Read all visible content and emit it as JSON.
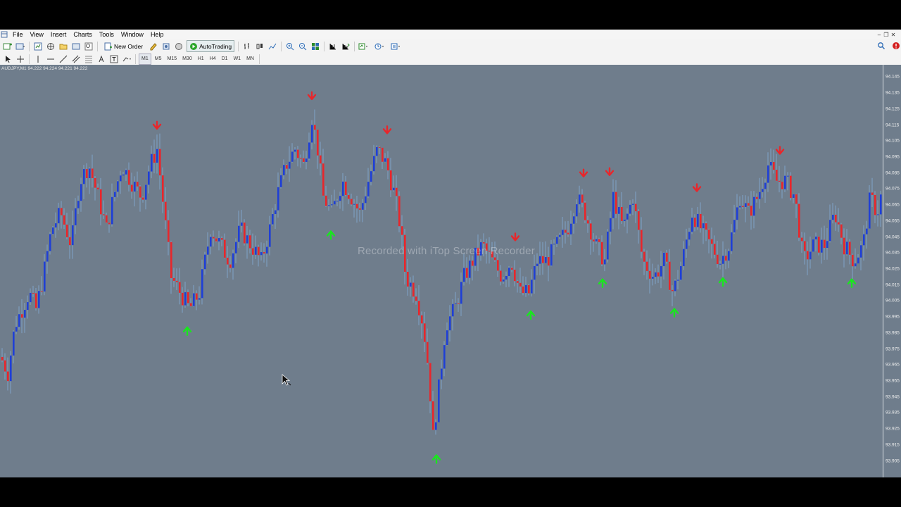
{
  "menu": [
    "File",
    "View",
    "Insert",
    "Charts",
    "Tools",
    "Window",
    "Help"
  ],
  "toolbar": {
    "new_order_label": "New Order",
    "autotrading_label": "AutoTrading"
  },
  "timeframes": [
    "M1",
    "M5",
    "M15",
    "M30",
    "H1",
    "H4",
    "D1",
    "W1",
    "MN"
  ],
  "active_timeframe": "M1",
  "chart_header": "AUDJPY,M1  94.222 94.224 94.221 94.222",
  "watermark": "Recorded with iTop Screen Recorder",
  "price_labels": [
    "94.145",
    "94.135",
    "94.125",
    "94.115",
    "94.105",
    "94.095",
    "94.085",
    "94.075",
    "94.065",
    "94.055",
    "94.045",
    "94.035",
    "94.025",
    "94.015",
    "94.005",
    "93.995",
    "93.985",
    "93.975",
    "93.965",
    "93.955",
    "93.945",
    "93.935",
    "93.925",
    "93.915",
    "93.905"
  ],
  "colors": {
    "background": "#6f7d8c",
    "bull_candle": "#1f3fd6",
    "bear_candle": "#e8262b",
    "wick": "#7fa3c8",
    "buy_arrow": "#19e61e",
    "sell_arrow": "#e8262b"
  },
  "chart_data": {
    "type": "candlestick",
    "symbol": "AUDJPY",
    "timeframe": "M1",
    "ylim": [
      93.9,
      94.15
    ],
    "close_points": [
      [
        0,
        93.97
      ],
      [
        10,
        93.96
      ],
      [
        20,
        93.99
      ],
      [
        30,
        94.0
      ],
      [
        40,
        94.01
      ],
      [
        50,
        94.0
      ],
      [
        60,
        94.02
      ],
      [
        72,
        94.05
      ],
      [
        85,
        94.06
      ],
      [
        100,
        94.04
      ],
      [
        112,
        94.08
      ],
      [
        125,
        94.09
      ],
      [
        138,
        94.07
      ],
      [
        150,
        94.05
      ],
      [
        160,
        94.07
      ],
      [
        172,
        94.09
      ],
      [
        185,
        94.08
      ],
      [
        200,
        94.07
      ],
      [
        212,
        94.09
      ],
      [
        222,
        94.1
      ],
      [
        232,
        94.06
      ],
      [
        242,
        94.02
      ],
      [
        255,
        94.01
      ],
      [
        268,
        94.0
      ],
      [
        282,
        94.01
      ],
      [
        298,
        94.05
      ],
      [
        312,
        94.04
      ],
      [
        325,
        94.03
      ],
      [
        340,
        94.05
      ],
      [
        355,
        94.04
      ],
      [
        370,
        94.03
      ],
      [
        382,
        94.05
      ],
      [
        392,
        94.07
      ],
      [
        405,
        94.09
      ],
      [
        418,
        94.1
      ],
      [
        430,
        94.09
      ],
      [
        442,
        94.12
      ],
      [
        450,
        94.1
      ],
      [
        458,
        94.07
      ],
      [
        470,
        94.06
      ],
      [
        485,
        94.08
      ],
      [
        498,
        94.07
      ],
      [
        510,
        94.06
      ],
      [
        522,
        94.08
      ],
      [
        535,
        94.1
      ],
      [
        548,
        94.09
      ],
      [
        560,
        94.07
      ],
      [
        568,
        94.05
      ],
      [
        575,
        94.02
      ],
      [
        590,
        94.01
      ],
      [
        600,
        93.99
      ],
      [
        608,
        93.96
      ],
      [
        614,
        93.92
      ],
      [
        622,
        93.95
      ],
      [
        632,
        93.99
      ],
      [
        645,
        94.0
      ],
      [
        658,
        94.02
      ],
      [
        670,
        94.03
      ],
      [
        684,
        94.04
      ],
      [
        698,
        94.03
      ],
      [
        712,
        94.02
      ],
      [
        725,
        94.03
      ],
      [
        738,
        94.01
      ],
      [
        750,
        94.01
      ],
      [
        762,
        94.03
      ],
      [
        775,
        94.03
      ],
      [
        790,
        94.04
      ],
      [
        805,
        94.05
      ],
      [
        818,
        94.07
      ],
      [
        830,
        94.06
      ],
      [
        845,
        94.04
      ],
      [
        858,
        94.03
      ],
      [
        870,
        94.07
      ],
      [
        884,
        94.05
      ],
      [
        898,
        94.07
      ],
      [
        912,
        94.03
      ],
      [
        928,
        94.02
      ],
      [
        942,
        94.03
      ],
      [
        955,
        94.01
      ],
      [
        968,
        94.03
      ],
      [
        982,
        94.06
      ],
      [
        995,
        94.05
      ],
      [
        1008,
        94.04
      ],
      [
        1022,
        94.03
      ],
      [
        1035,
        94.04
      ],
      [
        1050,
        94.07
      ],
      [
        1062,
        94.06
      ],
      [
        1075,
        94.07
      ],
      [
        1090,
        94.09
      ],
      [
        1102,
        94.08
      ],
      [
        1115,
        94.08
      ],
      [
        1128,
        94.07
      ],
      [
        1140,
        94.03
      ],
      [
        1155,
        94.04
      ],
      [
        1170,
        94.04
      ],
      [
        1185,
        94.06
      ],
      [
        1198,
        94.04
      ],
      [
        1212,
        94.03
      ],
      [
        1225,
        94.04
      ],
      [
        1235,
        94.07
      ],
      [
        1245,
        94.06
      ],
      [
        1250,
        94.07
      ]
    ],
    "buy_signals_x": [
      266,
      470,
      620,
      754,
      856,
      958,
      1027,
      1210
    ],
    "sell_signals_x": [
      223,
      443,
      550,
      732,
      829,
      866,
      990,
      1108
    ]
  }
}
